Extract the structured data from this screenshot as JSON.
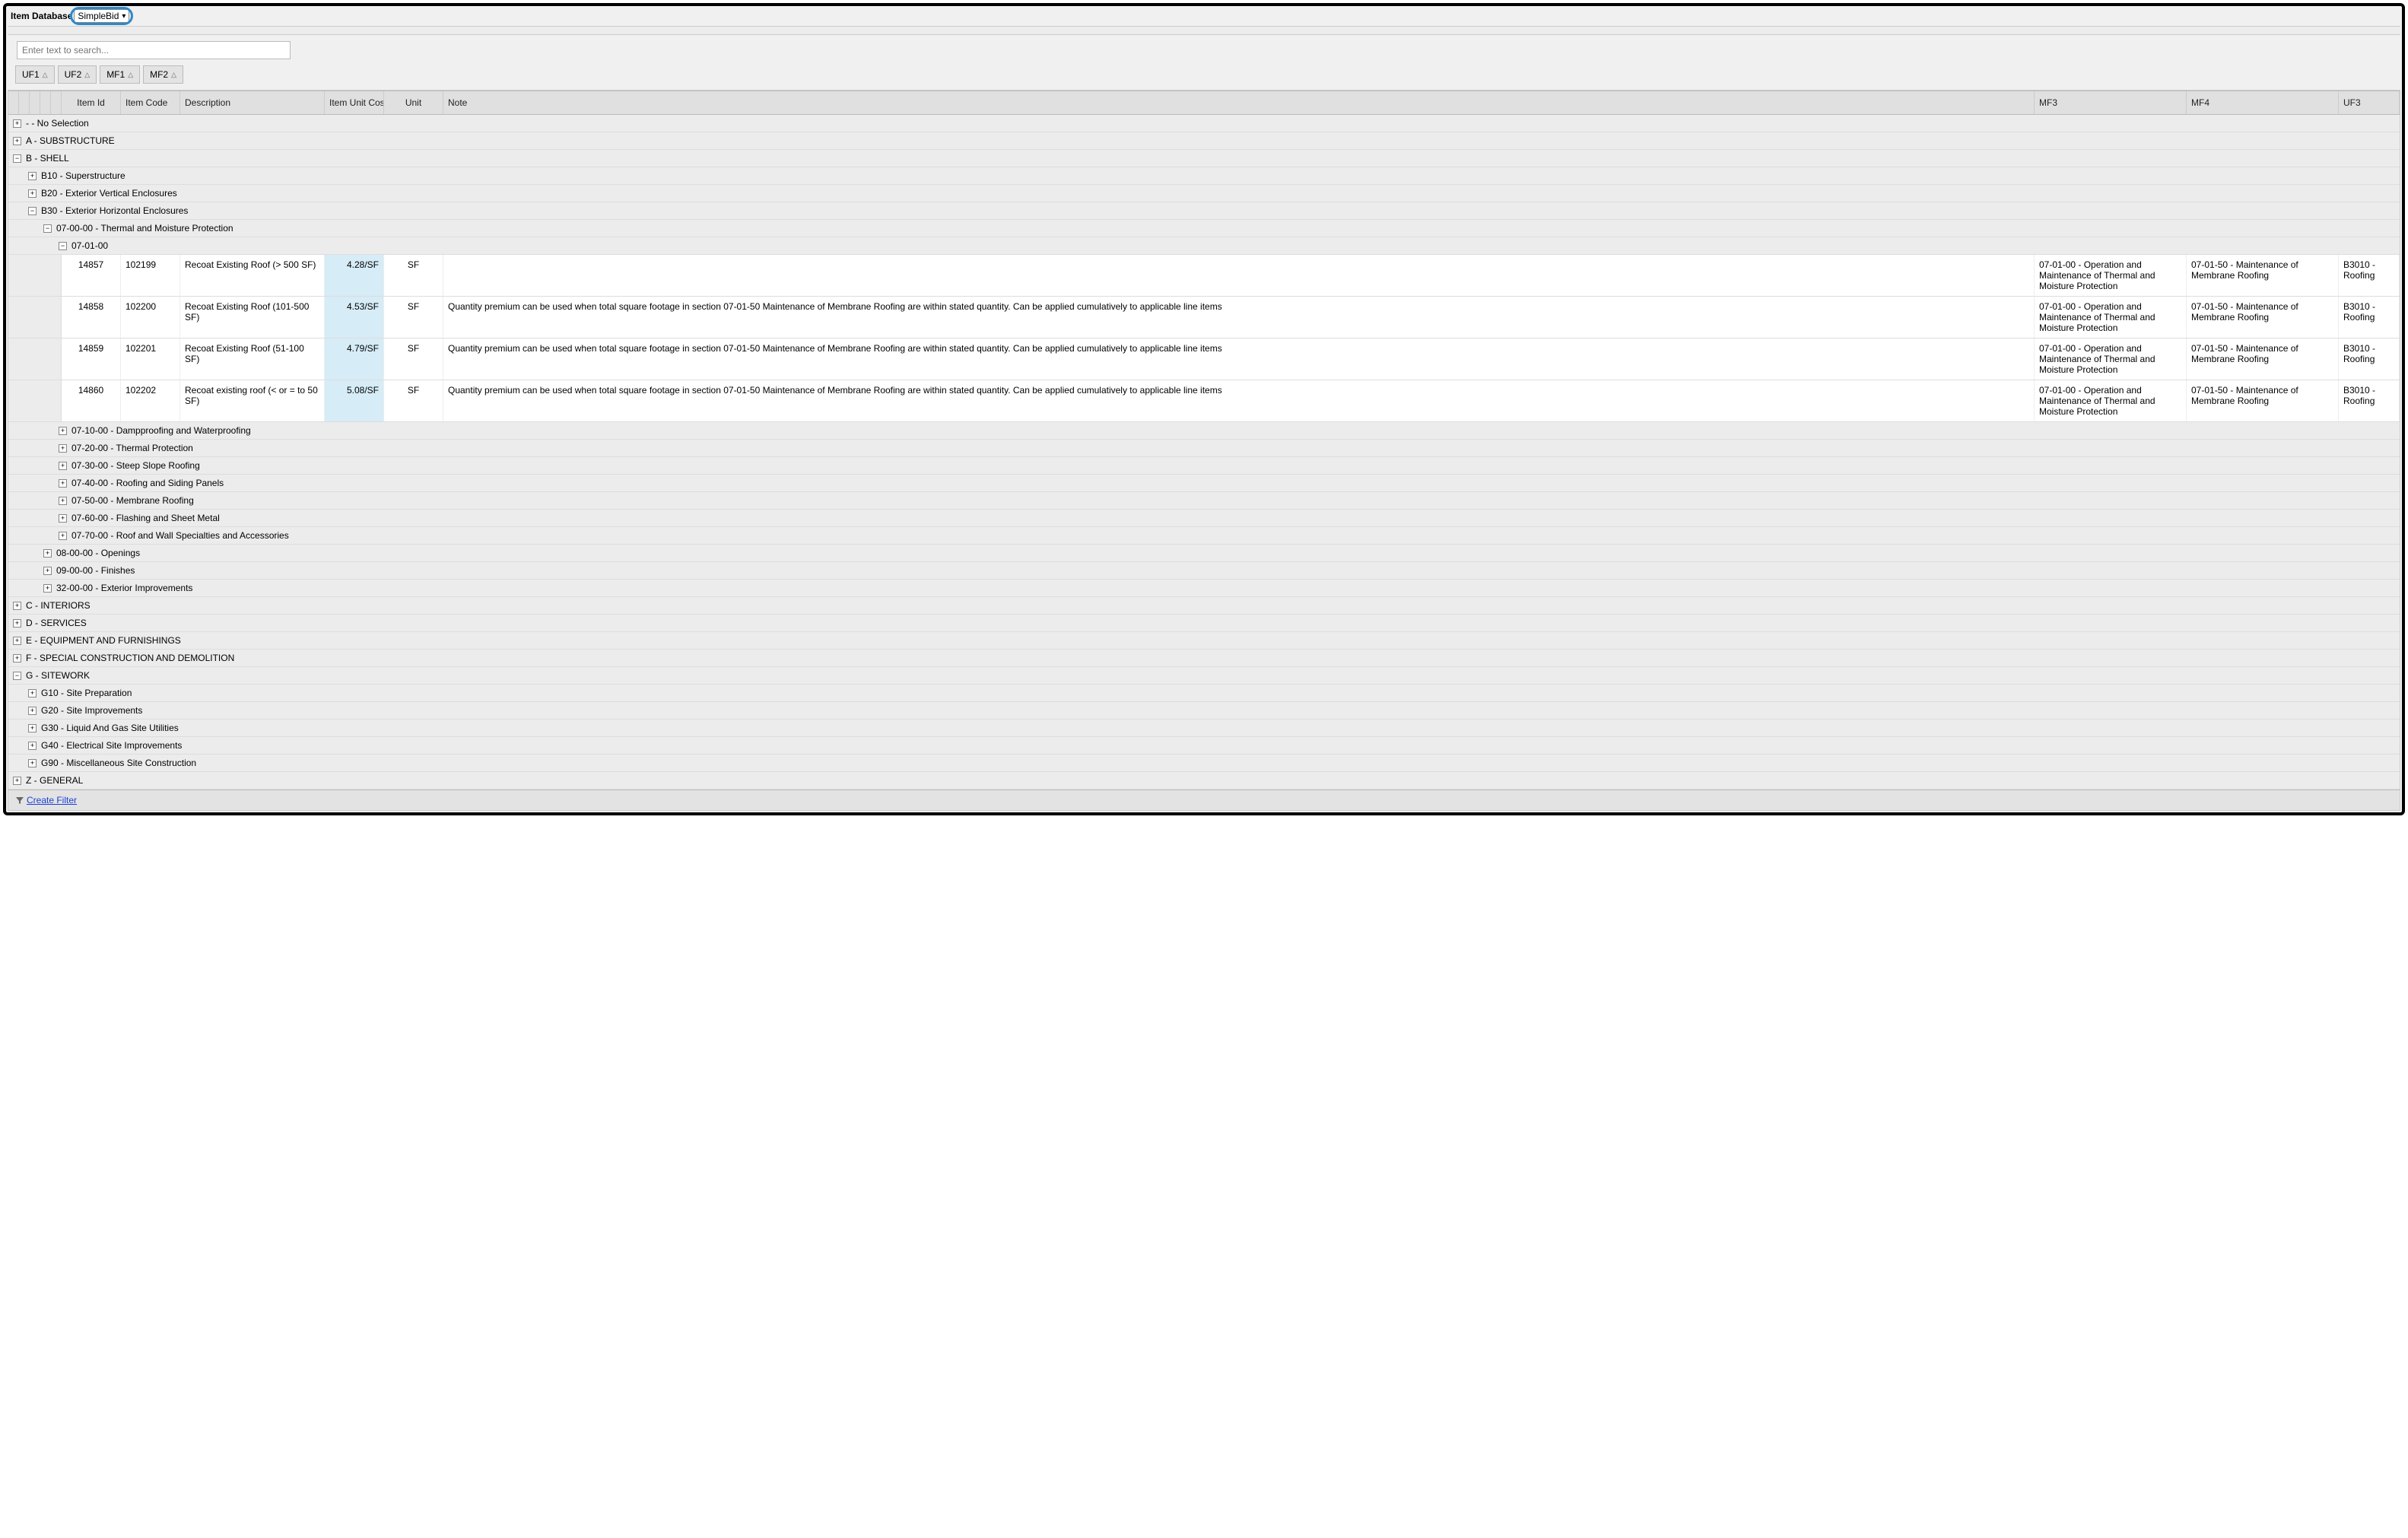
{
  "header": {
    "label": "Item Database",
    "selected_db": "SimpleBid"
  },
  "search": {
    "placeholder": "Enter text to search..."
  },
  "group_buttons": [
    "UF1",
    "UF2",
    "MF1",
    "MF2"
  ],
  "columns": {
    "item_id": "Item Id",
    "item_code": "Item Code",
    "description": "Description",
    "item_unit_cost": "Item Unit Cost",
    "unit": "Unit",
    "note": "Note",
    "mf3": "MF3",
    "mf4": "MF4",
    "uf3": "UF3"
  },
  "tree": {
    "no_selection": " -  - No Selection",
    "a": "A - SUBSTRUCTURE",
    "b": "B - SHELL",
    "b10": "B10 - Superstructure",
    "b20": "B20 - Exterior Vertical Enclosures",
    "b30": "B30 - Exterior Horizontal Enclosures",
    "t07_00_00": "07-00-00 - Thermal and Moisture Protection",
    "t07_01_00": "07-01-00",
    "t07_10_00": "07-10-00 - Dampproofing and Waterproofing",
    "t07_20_00": "07-20-00 - Thermal Protection",
    "t07_30_00": "07-30-00 - Steep Slope Roofing",
    "t07_40_00": "07-40-00 - Roofing and Siding Panels",
    "t07_50_00": "07-50-00 - Membrane Roofing",
    "t07_60_00": "07-60-00 - Flashing and Sheet Metal",
    "t07_70_00": "07-70-00 - Roof and Wall Specialties and Accessories",
    "t08_00_00": "08-00-00 - Openings",
    "t09_00_00": "09-00-00 - Finishes",
    "t32_00_00": "32-00-00 - Exterior Improvements",
    "c": "C - INTERIORS",
    "d": "D - SERVICES",
    "e": "E - EQUIPMENT AND FURNISHINGS",
    "f": "F - SPECIAL CONSTRUCTION AND DEMOLITION",
    "g": "G - SITEWORK",
    "g10": "G10 - Site Preparation",
    "g20": "G20 - Site Improvements",
    "g30": "G30 - Liquid And Gas Site Utilities",
    "g40": "G40 - Electrical Site Improvements",
    "g90": "G90 - Miscellaneous Site Construction",
    "z": "Z - GENERAL"
  },
  "rows": [
    {
      "item_id": "14857",
      "item_code": "102199",
      "description": "Recoat Existing Roof (> 500 SF)",
      "cost": "4.28/SF",
      "unit": "SF",
      "note": "",
      "mf3": "07-01-00 - Operation and Maintenance of Thermal and Moisture Protection",
      "mf4": "07-01-50 - Maintenance of Membrane Roofing",
      "uf3": "B3010 - Roofing"
    },
    {
      "item_id": "14858",
      "item_code": "102200",
      "description": "Recoat Existing Roof (101-500 SF)",
      "cost": "4.53/SF",
      "unit": "SF",
      "note": "Quantity premium can be used when total square footage in section 07-01-50 Maintenance of Membrane Roofing are within stated quantity. Can be applied cumulatively to applicable line items",
      "mf3": "07-01-00 - Operation and Maintenance of Thermal and Moisture Protection",
      "mf4": "07-01-50 - Maintenance of Membrane Roofing",
      "uf3": "B3010 - Roofing"
    },
    {
      "item_id": "14859",
      "item_code": "102201",
      "description": "Recoat Existing Roof (51-100 SF)",
      "cost": "4.79/SF",
      "unit": "SF",
      "note": "Quantity premium can be used when total square footage in section 07-01-50 Maintenance of Membrane Roofing are within stated quantity. Can be applied cumulatively to applicable line items",
      "mf3": "07-01-00 - Operation and Maintenance of Thermal and Moisture Protection",
      "mf4": "07-01-50 - Maintenance of Membrane Roofing",
      "uf3": "B3010 - Roofing"
    },
    {
      "item_id": "14860",
      "item_code": "102202",
      "description": "Recoat existing roof (< or = to 50 SF)",
      "cost": "5.08/SF",
      "unit": "SF",
      "note": "Quantity premium can be used when total square footage in section 07-01-50 Maintenance of Membrane Roofing are within stated quantity. Can be applied cumulatively to applicable line items",
      "mf3": "07-01-00 - Operation and Maintenance of Thermal and Moisture Protection",
      "mf4": "07-01-50 - Maintenance of Membrane Roofing",
      "uf3": "B3010 - Roofing"
    }
  ],
  "footer": {
    "create_filter": "Create Filter"
  }
}
